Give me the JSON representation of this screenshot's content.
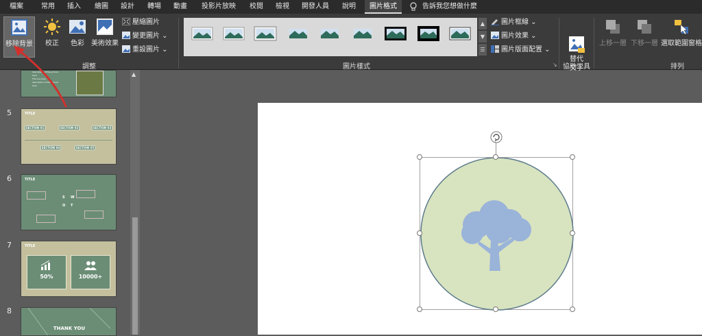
{
  "tabs": [
    {
      "label": "檔案",
      "active": false
    },
    {
      "label": "常用",
      "active": false
    },
    {
      "label": "插入",
      "active": false
    },
    {
      "label": "繪圖",
      "active": false
    },
    {
      "label": "設計",
      "active": false
    },
    {
      "label": "轉場",
      "active": false
    },
    {
      "label": "動畫",
      "active": false
    },
    {
      "label": "投影片放映",
      "active": false
    },
    {
      "label": "校閱",
      "active": false
    },
    {
      "label": "檢視",
      "active": false
    },
    {
      "label": "開發人員",
      "active": false
    },
    {
      "label": "說明",
      "active": false
    },
    {
      "label": "圖片格式",
      "active": true
    }
  ],
  "tell_me": "告訴我您想做什麼",
  "ribbon": {
    "adjust": {
      "remove_bg": "移除背景",
      "correct": "校正",
      "color": "色彩",
      "artistic": "美術效果",
      "compress": "壓縮圖片",
      "change": "變更圖片",
      "reset": "重設圖片",
      "group_label": "調整"
    },
    "styles": {
      "border": "圖片框線",
      "effects": "圖片效果",
      "layout": "圖片版面配置",
      "group_label": "圖片樣式"
    },
    "accessibility": {
      "alt_text": "替代\n文字",
      "group_label": "協助工具"
    },
    "arrange": {
      "bring_forward": "上移一層",
      "send_backward": "下移一層",
      "selection_pane": "選取範圍窗格",
      "group_label": "排列"
    }
  },
  "slides": [
    {
      "number": "",
      "title": "",
      "labels": [
        "description of the picture here",
        "The one topic",
        "description of the picture here"
      ]
    },
    {
      "number": "5",
      "title": "TITLE",
      "sections": [
        "SECTION 01",
        "SECTION 02",
        "SECTION 03",
        "SECTION 04",
        "SECTION 05"
      ]
    },
    {
      "number": "6",
      "title": "TITLE",
      "letters": [
        "S",
        "W",
        "O",
        "T"
      ]
    },
    {
      "number": "7",
      "title": "TITLE",
      "stats": [
        "50%",
        "10000+"
      ]
    },
    {
      "number": "8",
      "title": "THANK YOU"
    }
  ],
  "colors": {
    "accent_red": "#d0312d",
    "circle_fill": "#d8e3c0",
    "circle_stroke": "#5a7a8a",
    "tree_fill": "#9ab3d9",
    "slide_green": "#6b8d76",
    "slide_khaki": "#c4c09e"
  },
  "icons": [
    "remove-background-icon",
    "correct-icon",
    "color-icon",
    "artistic-effects-icon",
    "compress-icon",
    "change-picture-icon",
    "reset-picture-icon",
    "alt-text-icon",
    "rotate-handle-icon",
    "tree-icon",
    "lightbulb-icon"
  ]
}
